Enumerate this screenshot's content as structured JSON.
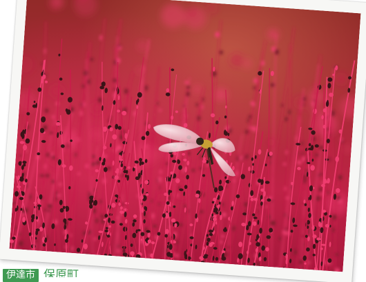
{
  "caption": {
    "badge_label": "伊達市",
    "text": "保原町"
  },
  "photo": {
    "subject": "dragonfly-on-red-grass",
    "colors": {
      "background_top": "#9d2c2a",
      "background_mid": "#b8243e",
      "foliage": "#c81e4a",
      "foliage_highlight": "#ee3c6e",
      "seed_dark": "#3a1418",
      "wing": "#f2d6dc",
      "dragonfly_body": "#2e2418",
      "dragonfly_thorax": "#c8a035",
      "border": "#f7f7f5",
      "caption_green": "#3f9a52"
    }
  }
}
